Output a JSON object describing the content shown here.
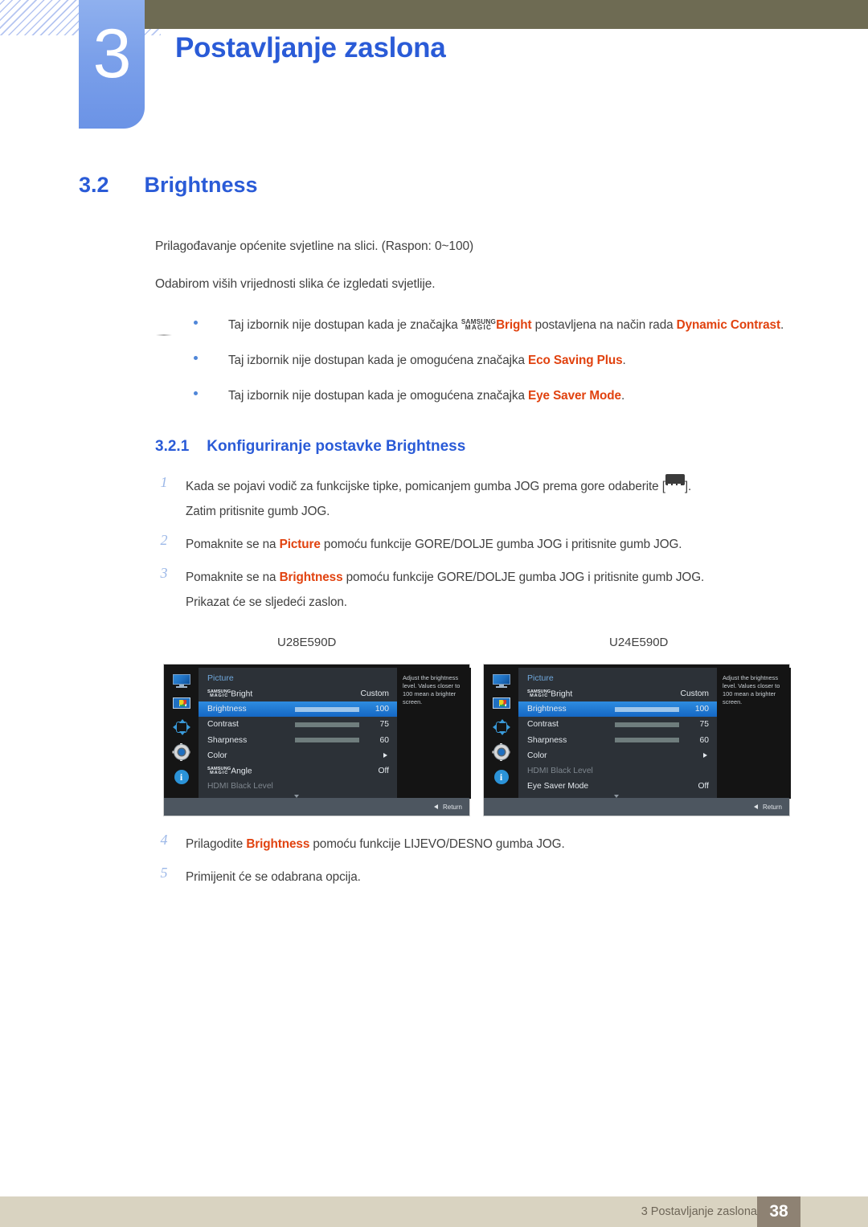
{
  "header": {
    "chapter_number": "3",
    "chapter_title": "Postavljanje zaslona"
  },
  "section": {
    "number": "3.2",
    "title": "Brightness"
  },
  "intro": {
    "line1": "Prilagođavanje općenite svjetline na slici. (Raspon: 0~100)",
    "line2": "Odabirom viših vrijednosti slika će izgledati svjetlije."
  },
  "notes": [
    {
      "pre": "Taj izbornik nije dostupan kada je značajka ",
      "magic_top": "SAMSUNG",
      "magic_bottom": "MAGIC",
      "magic_suffix": "Bright",
      "mid": " postavljena na način rada ",
      "highlight": "Dynamic Contrast",
      "post": "."
    },
    {
      "pre": "Taj izbornik nije dostupan kada je omogućena značajka ",
      "highlight": "Eco Saving Plus",
      "post": "."
    },
    {
      "pre": "Taj izbornik nije dostupan kada je omogućena značajka ",
      "highlight": "Eye Saver Mode",
      "post": "."
    }
  ],
  "subsection": {
    "number": "3.2.1",
    "title": "Konfiguriranje postavke Brightness"
  },
  "steps": [
    {
      "number": "1",
      "pre": "Kada se pojavi vodič za funkcijske tipke, pomicanjem gumba JOG prema gore odaberite [",
      "icon": "jog-menu-icon",
      "post": "].",
      "line2": "Zatim pritisnite gumb JOG."
    },
    {
      "number": "2",
      "pre": "Pomaknite se na ",
      "highlight": "Picture",
      "post": " pomoću funkcije GORE/DOLJE gumba JOG i pritisnite gumb JOG."
    },
    {
      "number": "3",
      "pre": "Pomaknite se na ",
      "highlight": "Brightness",
      "post": " pomoću funkcije GORE/DOLJE gumba JOG i pritisnite gumb JOG.",
      "line2": "Prikazat će se sljedeći zaslon."
    },
    {
      "number": "4",
      "pre": "Prilagodite ",
      "highlight": "Brightness",
      "post": " pomoću funkcije LIJEVO/DESNO gumba JOG."
    },
    {
      "number": "5",
      "pre": "Primijenit će se odabrana opcija.",
      "highlight": "",
      "post": ""
    }
  ],
  "figures": {
    "left": {
      "model": "U28E590D",
      "menu_title": "Picture",
      "description": "Adjust the brightness level. Values closer to 100 mean a brighter screen.",
      "return_label": "Return",
      "sidebar_icons": [
        "monitor-icon",
        "picture-icon",
        "onscreen-display-icon",
        "system-gear-icon",
        "information-icon"
      ],
      "rows": [
        {
          "label": "Bright",
          "magic_top": "SAMSUNG",
          "magic_bottom": "MAGIC",
          "value": "Custom",
          "type": "value"
        },
        {
          "label": "Brightness",
          "value": "100",
          "type": "slider",
          "fill": 100,
          "selected": true
        },
        {
          "label": "Contrast",
          "value": "75",
          "type": "slider",
          "fill": 75
        },
        {
          "label": "Sharpness",
          "value": "60",
          "type": "slider",
          "fill": 60
        },
        {
          "label": "Color",
          "value": "",
          "type": "submenu"
        },
        {
          "label": "Angle",
          "magic_top": "SAMSUNG",
          "magic_bottom": "MAGIC",
          "value": "Off",
          "type": "value"
        },
        {
          "label": "HDMI Black Level",
          "value": "",
          "type": "disabled"
        }
      ]
    },
    "right": {
      "model": "U24E590D",
      "menu_title": "Picture",
      "description": "Adjust the brightness level. Values closer to 100 mean a brighter screen.",
      "return_label": "Return",
      "sidebar_icons": [
        "monitor-icon",
        "picture-icon",
        "onscreen-display-icon",
        "system-gear-icon",
        "information-icon"
      ],
      "rows": [
        {
          "label": "Bright",
          "magic_top": "SAMSUNG",
          "magic_bottom": "MAGIC",
          "value": "Custom",
          "type": "value"
        },
        {
          "label": "Brightness",
          "value": "100",
          "type": "slider",
          "fill": 100,
          "selected": true
        },
        {
          "label": "Contrast",
          "value": "75",
          "type": "slider",
          "fill": 75
        },
        {
          "label": "Sharpness",
          "value": "60",
          "type": "slider",
          "fill": 60
        },
        {
          "label": "Color",
          "value": "",
          "type": "submenu"
        },
        {
          "label": "HDMI Black Level",
          "value": "",
          "type": "disabled"
        },
        {
          "label": "Eye Saver Mode",
          "value": "Off",
          "type": "value"
        }
      ]
    }
  },
  "footer": {
    "text": "3 Postavljanje zaslona",
    "page_number": "38"
  },
  "colors": {
    "accent_blue": "#2a5bd7",
    "highlight_orange": "#e1420f",
    "olive_bar": "#6e6b53",
    "footer_beige": "#d9d3c1",
    "page_box": "#8e8273"
  }
}
